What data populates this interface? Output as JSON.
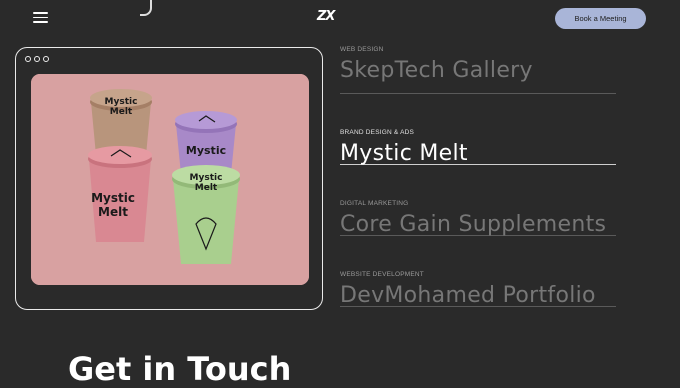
{
  "header": {
    "logo": "ZX",
    "cta_label": "Book a Meeting"
  },
  "colors": {
    "background": "#2a2a2a",
    "accent": "#a9b5d8",
    "preview_bg": "#d6a0a0"
  },
  "projects": [
    {
      "category": "WEB DESIGN",
      "title": "SkepTech Gallery",
      "active": false
    },
    {
      "category": "BRAND DESIGN & ADS",
      "title": "Mystic Melt",
      "active": true
    },
    {
      "category": "DIGITAL MARKETING",
      "title": "Core Gain Supplements",
      "active": false
    },
    {
      "category": "WEBSITE DEVELOPMENT",
      "title": "DevMohamed Portfolio",
      "active": false
    }
  ],
  "preview": {
    "product_text": "Mystic Melt"
  },
  "contact": {
    "title": "Get in Touch"
  }
}
